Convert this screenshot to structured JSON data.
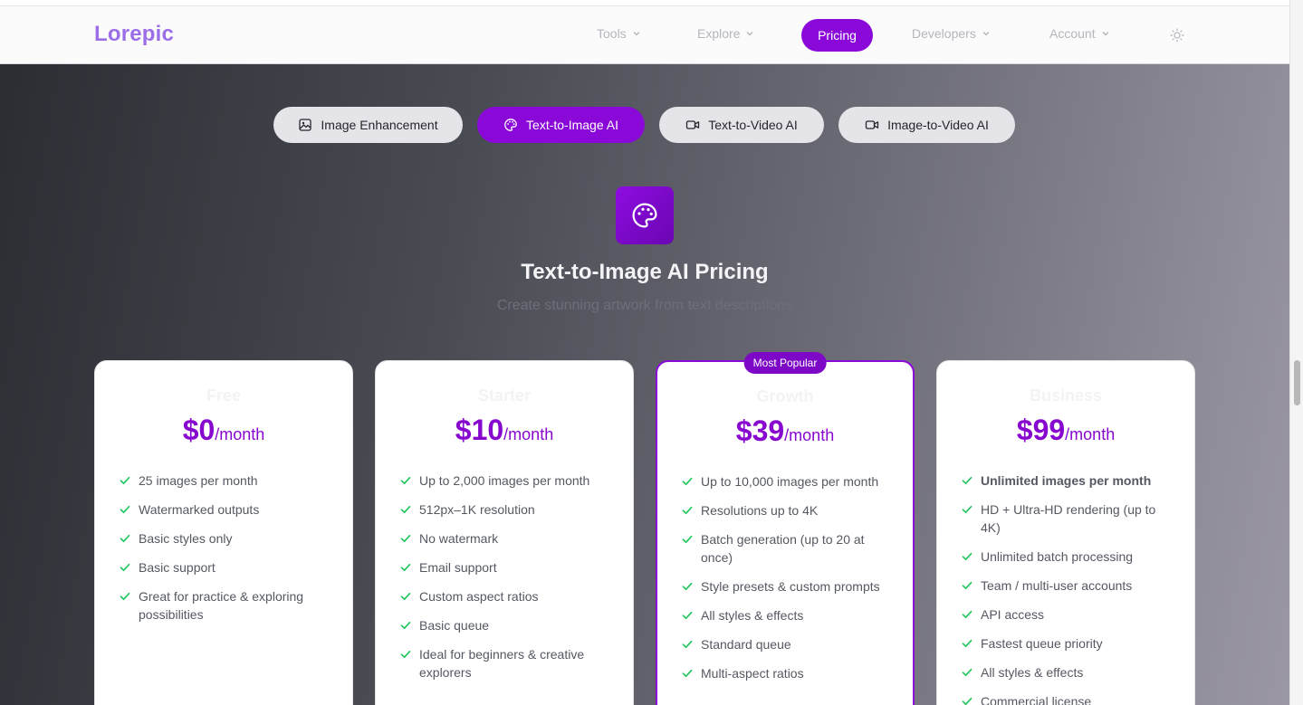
{
  "nav": {
    "logo": "Lorepic",
    "items": [
      {
        "label": "Tools"
      },
      {
        "label": "Explore"
      },
      {
        "label": "Pricing"
      },
      {
        "label": "Developers"
      },
      {
        "label": "Account"
      }
    ],
    "theme_icon": "sun-icon"
  },
  "tabs": [
    {
      "label": "Image Enhancement",
      "icon": "image-icon"
    },
    {
      "label": "Text-to-Image AI",
      "icon": "palette-icon"
    },
    {
      "label": "Text-to-Video AI",
      "icon": "video-icon"
    },
    {
      "label": "Image-to-Video AI",
      "icon": "video-icon"
    }
  ],
  "hero": {
    "icon": "palette-icon",
    "title": "Text-to-Image AI Pricing",
    "subtitle": "Create stunning artwork from text descriptions"
  },
  "plans": [
    {
      "name": "Free",
      "price": "$0",
      "period": "/month",
      "features": [
        "25 images per month",
        "Watermarked outputs",
        "Basic styles only",
        "Basic support",
        "Great for practice & exploring possibilities"
      ]
    },
    {
      "name": "Starter",
      "price": "$10",
      "period": "/month",
      "features": [
        "Up to 2,000 images per month",
        "512px–1K resolution",
        "No watermark",
        "Email support",
        "Custom aspect ratios",
        "Basic queue",
        "Ideal for beginners & creative explorers"
      ]
    },
    {
      "name": "Growth",
      "price": "$39",
      "period": "/month",
      "badge": "Most Popular",
      "features": [
        "Up to 10,000 images per month",
        "Resolutions up to 4K",
        "Batch generation (up to 20 at once)",
        "Style presets & custom prompts",
        "All styles & effects",
        "Standard queue",
        "Multi-aspect ratios"
      ]
    },
    {
      "name": "Business",
      "price": "$99",
      "period": "/month",
      "features": [
        "Unlimited images per month",
        "HD + Ultra-HD rendering (up to 4K)",
        "Unlimited batch processing",
        "Team / multi-user accounts",
        "API access",
        "Fastest queue priority",
        "All styles & effects",
        "Commercial license"
      ]
    }
  ],
  "colors": {
    "accent": "#8b09d8",
    "check": "#22c55e",
    "logo": "#9b6ee8"
  }
}
